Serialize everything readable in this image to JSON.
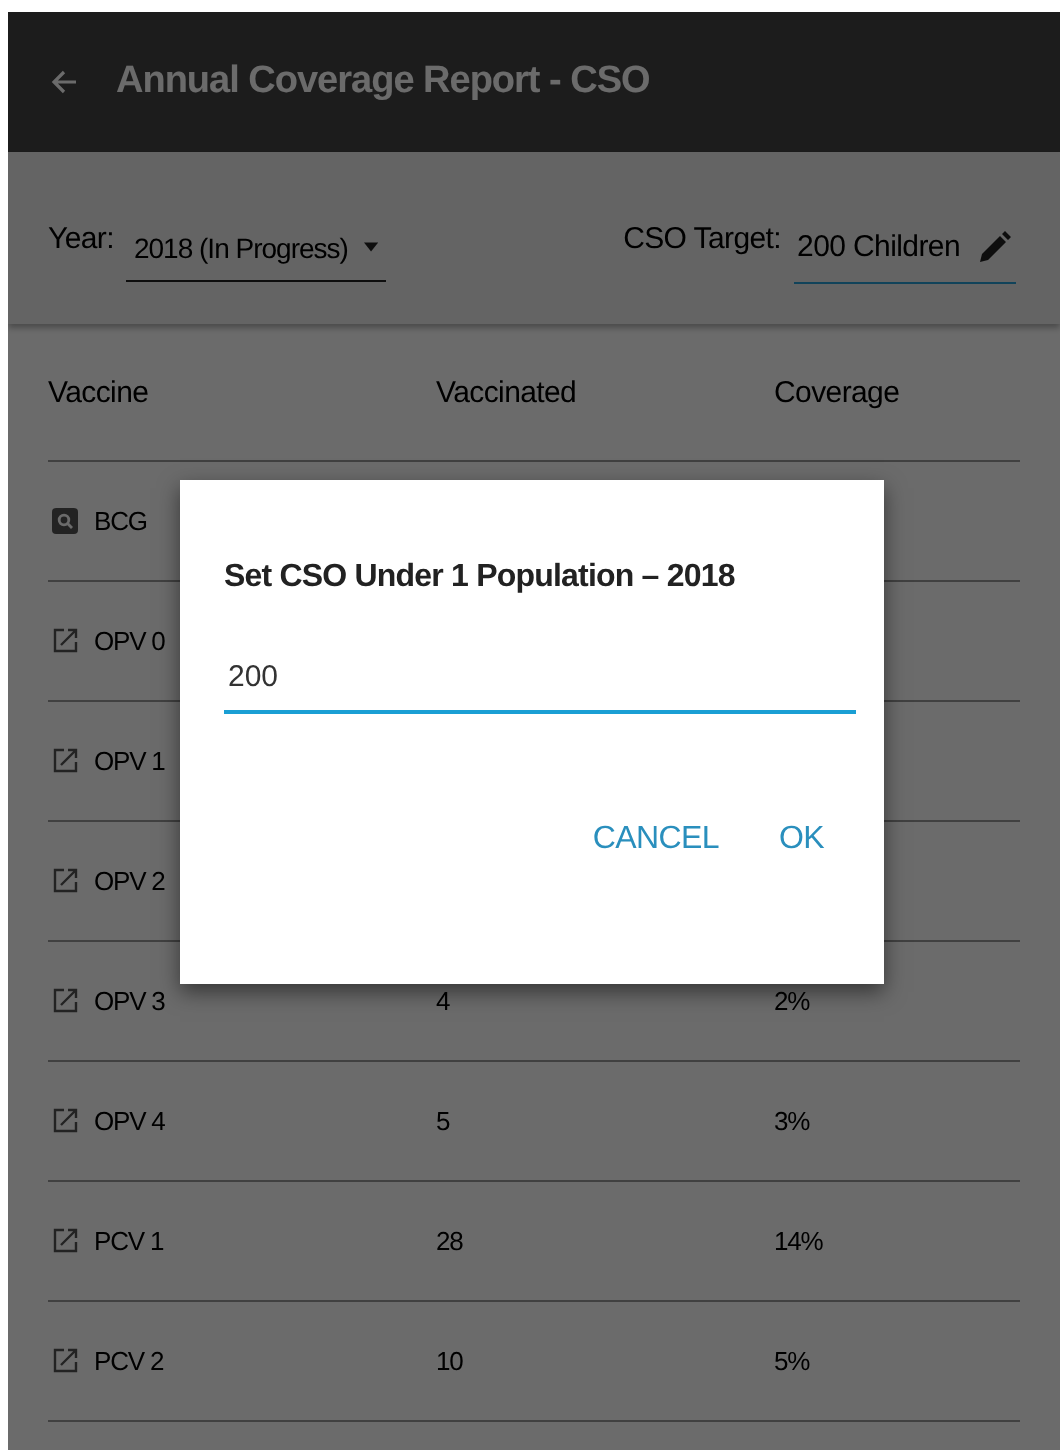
{
  "app_bar": {
    "title": "Annual Coverage Report - CSO"
  },
  "filters": {
    "year_label": "Year:",
    "year_value": "2018 (In Progress)",
    "target_label": "CSO Target:",
    "target_value": "200 Children"
  },
  "table": {
    "columns": [
      "Vaccine",
      "Vaccinated",
      "Coverage"
    ],
    "rows": [
      {
        "kind": "view",
        "vaccine": "BCG"
      },
      {
        "kind": "edit",
        "vaccine": "OPV 0"
      },
      {
        "kind": "edit",
        "vaccine": "OPV 1"
      },
      {
        "kind": "edit",
        "vaccine": "OPV 2"
      },
      {
        "kind": "edit",
        "vaccine": "OPV 3",
        "vaccinated": "4",
        "coverage": "2%"
      },
      {
        "kind": "edit",
        "vaccine": "OPV 4",
        "vaccinated": "5",
        "coverage": "3%"
      },
      {
        "kind": "edit",
        "vaccine": "PCV 1",
        "vaccinated": "28",
        "coverage": "14%"
      },
      {
        "kind": "edit",
        "vaccine": "PCV 2",
        "vaccinated": "10",
        "coverage": "5%"
      }
    ]
  },
  "dialog": {
    "title": "Set CSO Under 1 Population – 2018",
    "value": "200",
    "buttons": [
      "CANCEL",
      "OK"
    ]
  }
}
